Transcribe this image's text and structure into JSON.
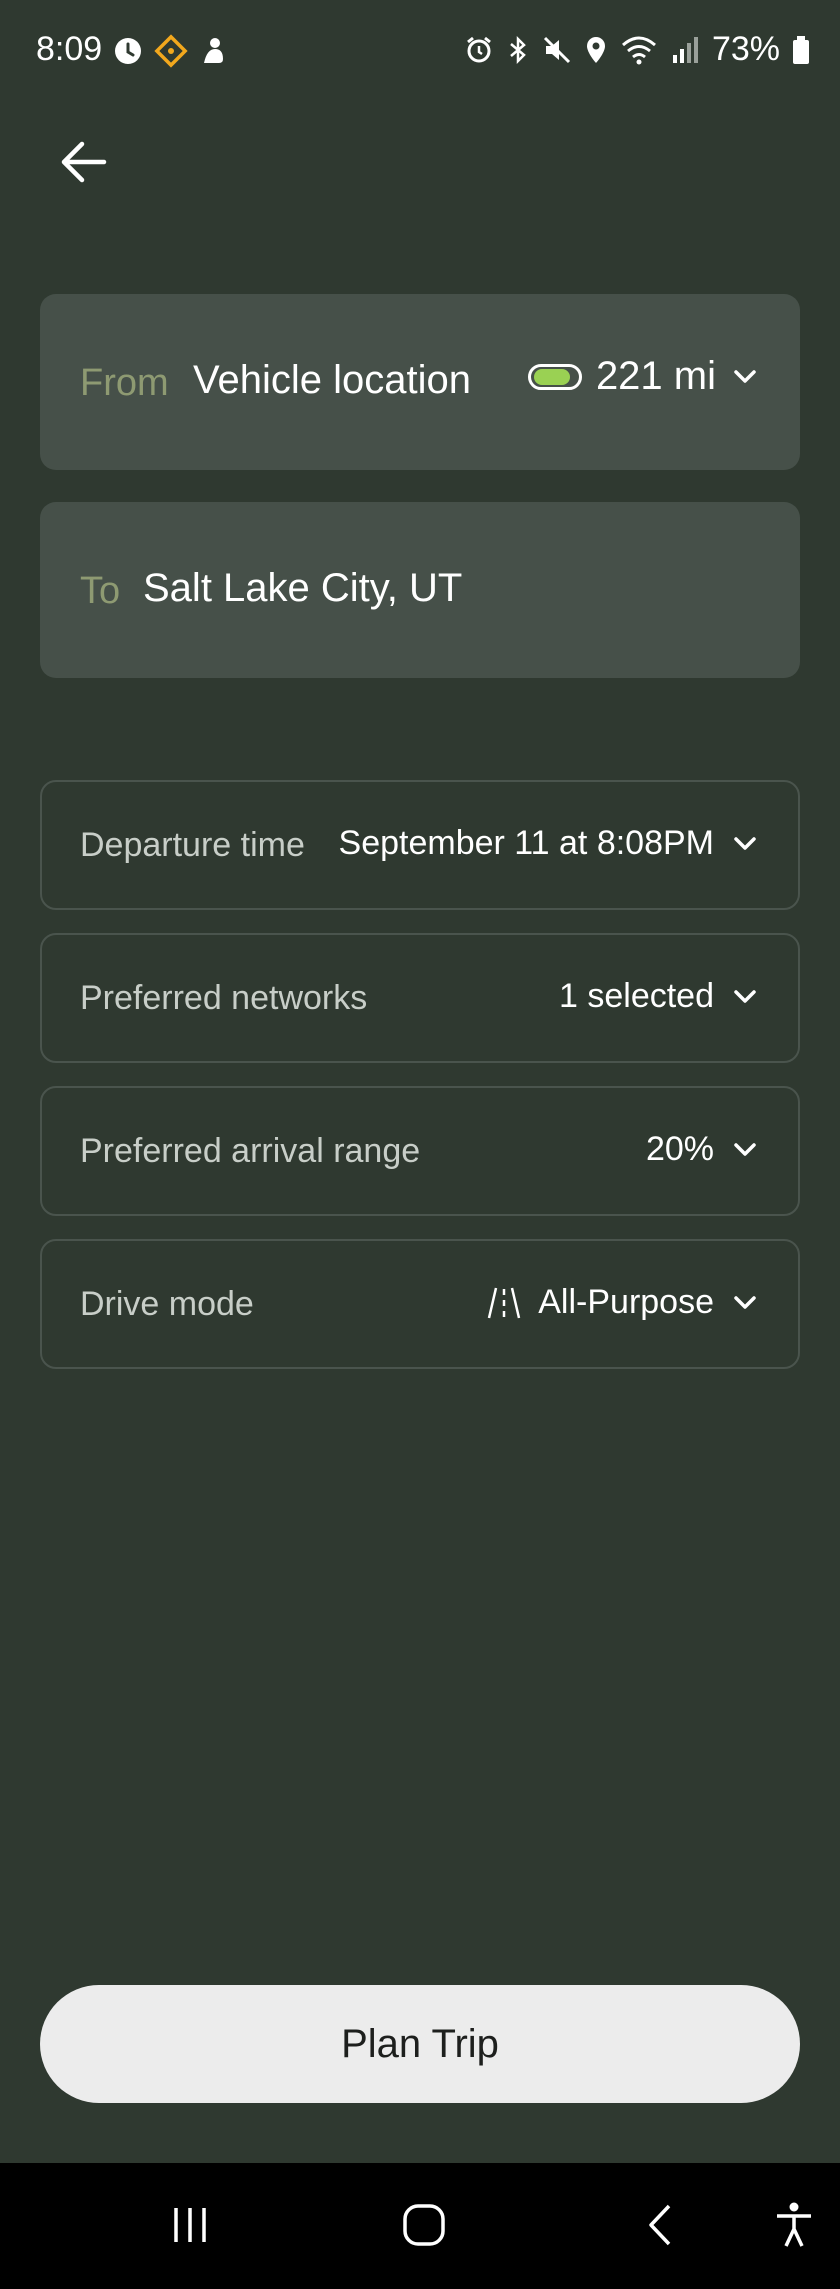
{
  "status_bar": {
    "time": "8:09",
    "battery_percent": "73%",
    "left_icons": [
      "timer-icon",
      "navigation-diamond-icon",
      "app-notification-icon"
    ],
    "right_icons": [
      "alarm-icon",
      "bluetooth-icon",
      "mute-icon",
      "location-icon",
      "wifi-icon",
      "signal-icon",
      "battery-icon"
    ],
    "accent_color": "#f2a81d"
  },
  "header": {
    "back_icon": "arrow-left-icon"
  },
  "from": {
    "label": "From",
    "value": "Vehicle location",
    "range": "221 mi",
    "battery_level": 0.85,
    "battery_color": "#9ad153"
  },
  "to": {
    "label": "To",
    "value": "Salt Lake City, UT"
  },
  "options": [
    {
      "label": "Departure time",
      "value": "September 11 at 8:08PM"
    },
    {
      "label": "Preferred networks",
      "value": "1 selected"
    },
    {
      "label": "Preferred arrival range",
      "value": "20%"
    },
    {
      "label": "Drive mode",
      "value": "All-Purpose",
      "icon": "road-icon"
    }
  ],
  "actions": {
    "plan_trip": "Plan Trip"
  },
  "nav_bar": {
    "items": [
      "recents-icon",
      "home-icon",
      "back-icon",
      "accessibility-icon"
    ]
  },
  "colors": {
    "background": "#2f3930",
    "card": "#465049",
    "label_accent": "#8e9a72",
    "border": "#4a544d",
    "button": "#ececec"
  }
}
